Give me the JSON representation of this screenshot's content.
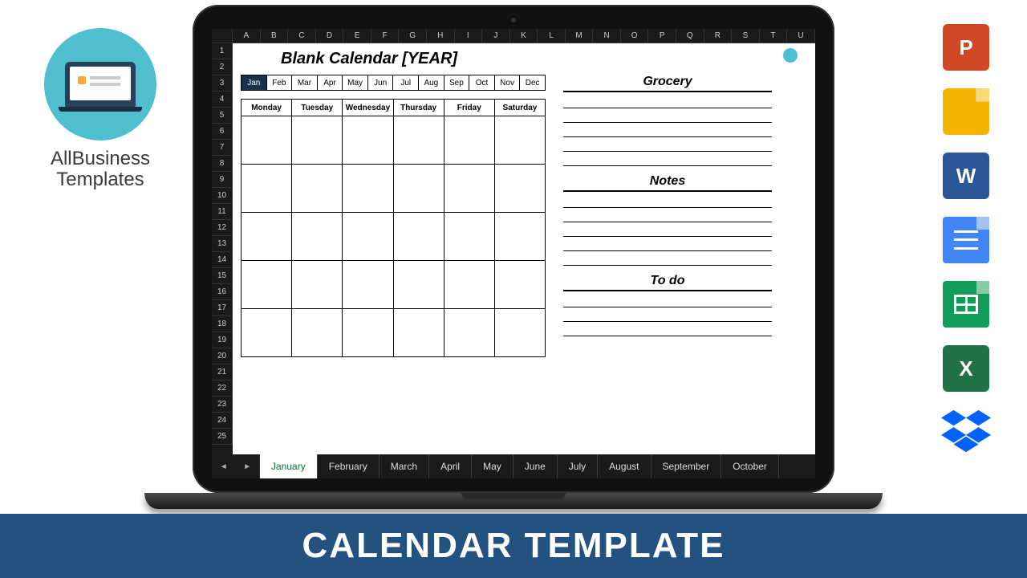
{
  "brand": {
    "line1": "AllBusiness",
    "line2": "Templates"
  },
  "banner": "CALENDAR TEMPLATE",
  "icons": {
    "powerpoint": "P",
    "slides": "",
    "word": "W",
    "docs": "",
    "sheets": "",
    "excel": "X",
    "dropbox": ""
  },
  "spreadsheet": {
    "columns": [
      "A",
      "B",
      "C",
      "D",
      "E",
      "F",
      "G",
      "H",
      "I",
      "J",
      "K",
      "L",
      "M",
      "N",
      "O",
      "P",
      "Q",
      "R",
      "S",
      "T",
      "U"
    ],
    "rows_visible": 25,
    "title": "Blank Calendar [YEAR]",
    "month_tabs": [
      "Jan",
      "Feb",
      "Mar",
      "Apr",
      "May",
      "Jun",
      "Jul",
      "Aug",
      "Sep",
      "Oct",
      "Nov",
      "Dec"
    ],
    "active_month_index": 0,
    "day_headers": [
      "Monday",
      "Tuesday",
      "Wednesday",
      "Thursday",
      "Friday",
      "Saturday"
    ],
    "calendar_weeks": 5,
    "side_sections": [
      {
        "title": "Grocery",
        "lines": 5
      },
      {
        "title": "Notes",
        "lines": 5
      },
      {
        "title": "To do",
        "lines": 3
      }
    ],
    "sheet_tabs": [
      "January",
      "February",
      "March",
      "April",
      "May",
      "June",
      "July",
      "August",
      "September",
      "October"
    ],
    "active_sheet_index": 0
  }
}
